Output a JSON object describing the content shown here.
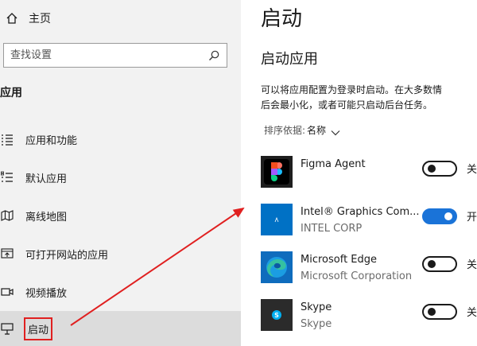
{
  "sidebar": {
    "home_label": "主页",
    "search_placeholder": "查找设置",
    "section_title": "应用",
    "items": [
      {
        "label": "应用和功能"
      },
      {
        "label": "默认应用"
      },
      {
        "label": "离线地图"
      },
      {
        "label": "可打开网站的应用"
      },
      {
        "label": "视频播放"
      },
      {
        "label": "启动"
      }
    ]
  },
  "main": {
    "title": "启动",
    "subtitle": "启动应用",
    "description_line1": "可以将应用配置为登录时启动。在大多数情",
    "description_line2": "后会最小化，或者可能只启动后台任务。",
    "sort_key": "排序依据:",
    "sort_value": "名称",
    "apps": [
      {
        "name": "Figma Agent",
        "publisher": "",
        "state": "关",
        "on": false
      },
      {
        "name": "Intel® Graphics Com...",
        "publisher": "INTEL CORP",
        "state": "开",
        "on": true
      },
      {
        "name": "Microsoft Edge",
        "publisher": "Microsoft Corporation",
        "state": "关",
        "on": false
      },
      {
        "name": "Skype",
        "publisher": "Skype",
        "state": "关",
        "on": false
      }
    ]
  },
  "colors": {
    "toggle_on": "#1a73d8",
    "annotation_red": "#e02020",
    "sidebar_bg": "#f2f2f2",
    "active_bg": "#dcdcdc"
  }
}
